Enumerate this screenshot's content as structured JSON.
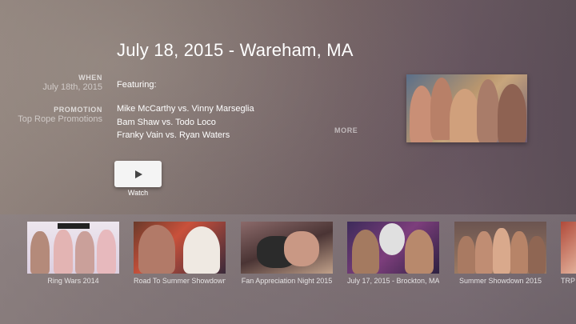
{
  "event": {
    "title": "July 18, 2015 - Wareham, MA",
    "when_label": "WHEN",
    "when_value": "July 18th, 2015",
    "promotion_label": "PROMOTION",
    "promotion_value": "Top Rope Promotions",
    "featuring_label": "Featuring:",
    "matches": [
      "Mike McCarthy vs. Vinny Marseglia",
      "Bam Shaw vs. Todo Loco",
      "Franky Vain vs. Ryan Waters"
    ],
    "more_label": "MORE"
  },
  "play": {
    "label": "Watch",
    "icon": "play-icon"
  },
  "shelf": {
    "items": [
      {
        "label": "Ring Wars 2014",
        "banner": "TOP ROPE PROMOTIONS"
      },
      {
        "label": "Road To Summer Showdown"
      },
      {
        "label": "Fan Appreciation Night 2015"
      },
      {
        "label": "July 17, 2015 - Brockton, MA"
      },
      {
        "label": "Summer Showdown 2015"
      },
      {
        "label": "TRP"
      }
    ]
  }
}
